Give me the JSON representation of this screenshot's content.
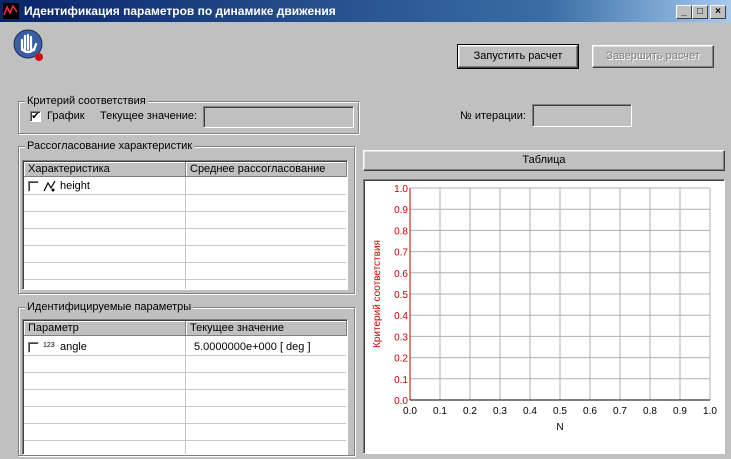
{
  "window": {
    "title": "Идентификация параметров по динамике движения",
    "minimize": "_",
    "maximize": "□",
    "close": "×"
  },
  "toolbar": {
    "start_label": "Запустить расчет",
    "stop_label": "Завершить расчет"
  },
  "criterion": {
    "group_label": "Критерий соответствия",
    "graph_check": "✔",
    "graph_label": "График",
    "current_label": "Текущее значение:",
    "current_value": ""
  },
  "iteration": {
    "label": "№ итерации:",
    "value": ""
  },
  "mismatch": {
    "group_label": "Рассогласование характеристик",
    "col1": "Характеристика",
    "col2": "Среднее рассогласование",
    "rows": [
      {
        "name": "height",
        "value": ""
      }
    ]
  },
  "params": {
    "group_label": "Идентифицируемые параметры",
    "col1": "Параметр",
    "col2": "Текущее значение",
    "rows": [
      {
        "type_icon": "123",
        "name": "angle",
        "value": "5.0000000e+000  [ deg ]"
      }
    ]
  },
  "table_button": "Таблица",
  "chart_data": {
    "type": "line",
    "xlabel": "N",
    "ylabel": "Критерий соответствия",
    "xlim": [
      0.0,
      1.0
    ],
    "ylim": [
      0.0,
      1.0
    ],
    "xticks": [
      "0.0",
      "0.1",
      "0.2",
      "0.3",
      "0.4",
      "0.5",
      "0.6",
      "0.7",
      "0.8",
      "0.9",
      "1.0"
    ],
    "yticks": [
      "0.0",
      "0.1",
      "0.2",
      "0.3",
      "0.4",
      "0.5",
      "0.6",
      "0.7",
      "0.8",
      "0.9",
      "1.0"
    ],
    "grid": true,
    "series": [],
    "colors": {
      "axis": "#cc0000",
      "grid": "#b0b0b0"
    }
  }
}
